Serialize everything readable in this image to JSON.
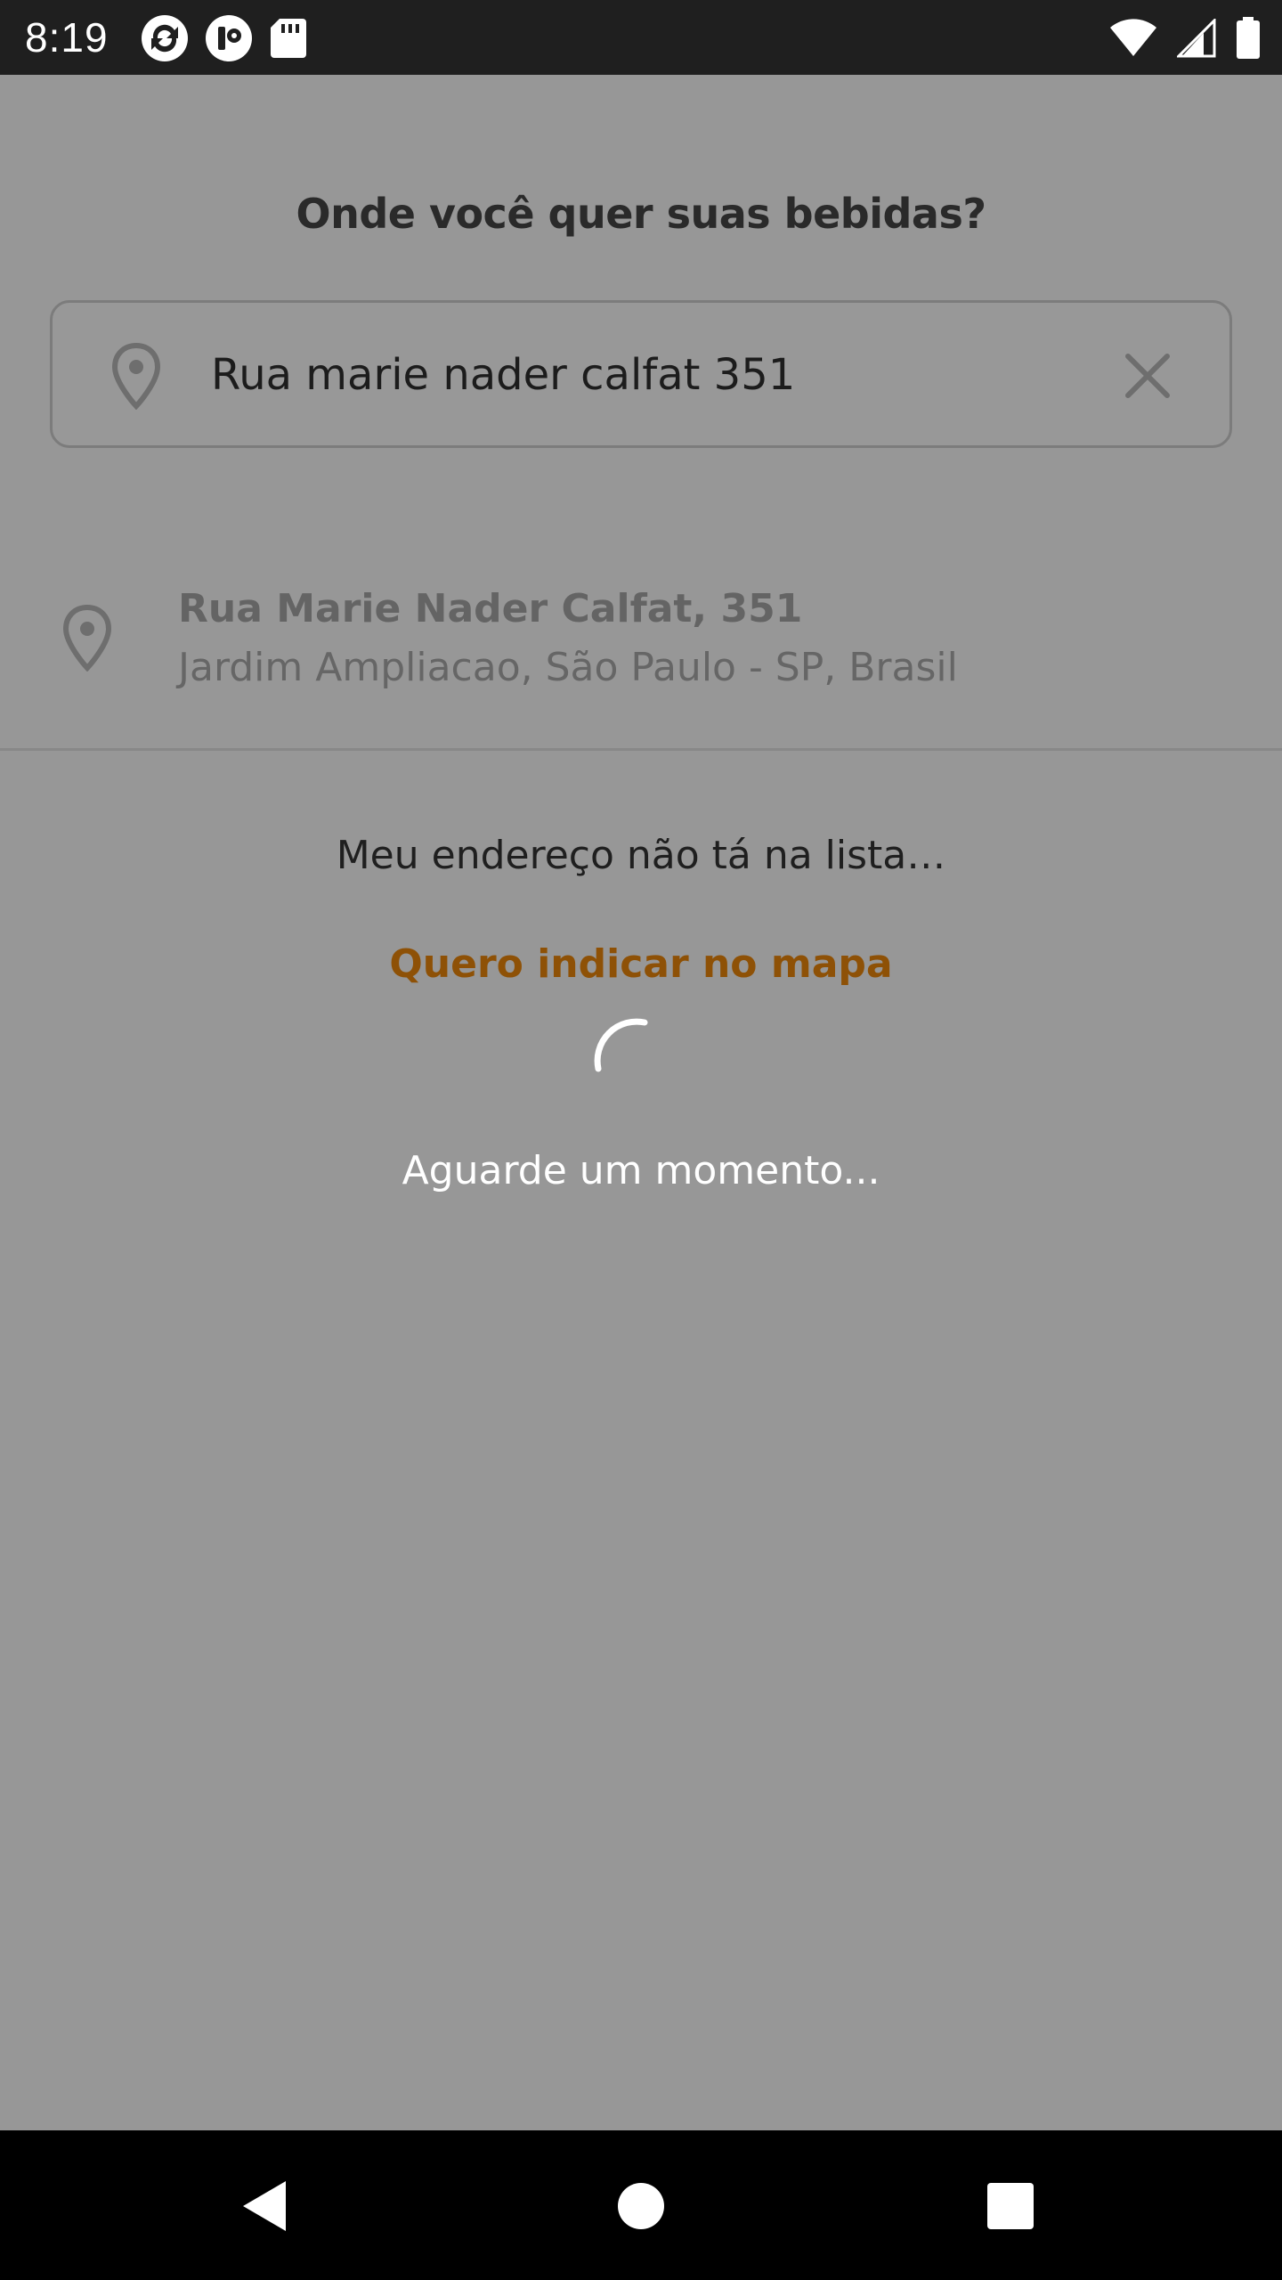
{
  "status_bar": {
    "time": "8:19",
    "left_icons": [
      "sync-icon",
      "app-icon",
      "sd-card-icon"
    ],
    "right_icons": [
      "wifi-icon",
      "signal-icon",
      "battery-icon"
    ]
  },
  "header": {
    "title": "Onde você quer suas bebidas?"
  },
  "search": {
    "value": "Rua marie nader calfat 351",
    "icon": "location-pin-icon",
    "clear_icon": "close-icon"
  },
  "results": [
    {
      "title": "Rua Marie Nader Calfat, 351",
      "subtitle": "Jardim Ampliacao, São Paulo - SP, Brasil",
      "icon": "location-pin-icon"
    }
  ],
  "not_listed": {
    "text": "Meu endereço não tá na lista…",
    "link_label": "Quero indicar no mapa"
  },
  "loading": {
    "text": "Aguarde um momento..."
  },
  "nav": {
    "buttons": [
      "back-icon",
      "home-icon",
      "recents-icon"
    ]
  },
  "colors": {
    "overlay": "#979797",
    "link": "#8e5106",
    "status_bar": "#1f1f1f",
    "nav_bar": "#000000"
  }
}
